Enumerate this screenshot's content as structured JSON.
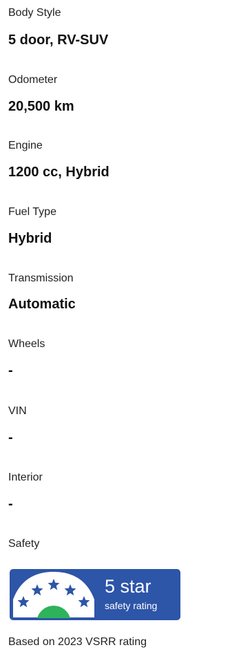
{
  "specs": [
    {
      "label": "Body Style",
      "value": "5 door, RV-SUV"
    },
    {
      "label": "Odometer",
      "value": "20,500 km"
    },
    {
      "label": "Engine",
      "value": "1200 cc, Hybrid"
    },
    {
      "label": "Fuel Type",
      "value": "Hybrid"
    },
    {
      "label": "Transmission",
      "value": "Automatic"
    },
    {
      "label": "Wheels",
      "value": "-"
    },
    {
      "label": "VIN",
      "value": "-"
    },
    {
      "label": "Interior",
      "value": "-"
    }
  ],
  "safety": {
    "label": "Safety",
    "badge_title": "5 star",
    "badge_subtitle": "safety rating",
    "star_rating": 5,
    "max_stars": 5,
    "badge_color": "#2d55a8",
    "star_color": "#2d55a8",
    "dome_color": "#2db35a",
    "footnote": "Based on 2023 VSRR rating"
  }
}
